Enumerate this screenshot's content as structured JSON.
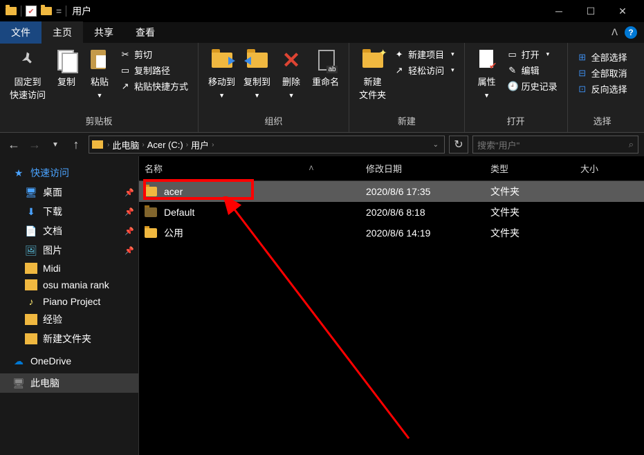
{
  "title": "用户",
  "menu": {
    "file": "文件",
    "home": "主页",
    "share": "共享",
    "view": "查看"
  },
  "ribbon": {
    "clipboard": {
      "label": "剪贴板",
      "pin": "固定到\n快速访问",
      "copy": "复制",
      "paste": "粘贴",
      "cut": "剪切",
      "copypath": "复制路径",
      "pasteshortcut": "粘贴快捷方式"
    },
    "organize": {
      "label": "组织",
      "moveto": "移动到",
      "copyto": "复制到",
      "delete": "删除",
      "rename": "重命名"
    },
    "new": {
      "label": "新建",
      "newfolder": "新建\n文件夹",
      "newitem": "新建项目",
      "easyaccess": "轻松访问"
    },
    "open": {
      "label": "打开",
      "properties": "属性",
      "open": "打开",
      "edit": "编辑",
      "history": "历史记录"
    },
    "select": {
      "label": "选择",
      "all": "全部选择",
      "none": "全部取消",
      "invert": "反向选择"
    }
  },
  "breadcrumb": [
    "此电脑",
    "Acer (C:)",
    "用户"
  ],
  "search_placeholder": "搜索\"用户\"",
  "columns": {
    "name": "名称",
    "date": "修改日期",
    "type": "类型",
    "size": "大小"
  },
  "files": [
    {
      "name": "acer",
      "date": "2020/8/6 17:35",
      "type": "文件夹",
      "selected": true,
      "highlighted": true
    },
    {
      "name": "Default",
      "date": "2020/8/6 8:18",
      "type": "文件夹",
      "dim": true
    },
    {
      "name": "公用",
      "date": "2020/8/6 14:19",
      "type": "文件夹"
    }
  ],
  "sidebar": {
    "quickaccess": "快速访问",
    "items": [
      {
        "label": "桌面",
        "icon": "desktop",
        "pinned": true
      },
      {
        "label": "下载",
        "icon": "download",
        "pinned": true
      },
      {
        "label": "文档",
        "icon": "doc",
        "pinned": true
      },
      {
        "label": "图片",
        "icon": "pic",
        "pinned": true
      },
      {
        "label": "Midi",
        "icon": "fld"
      },
      {
        "label": "osu mania rank",
        "icon": "fld"
      },
      {
        "label": "Piano Project",
        "icon": "music"
      },
      {
        "label": "经验",
        "icon": "fld"
      },
      {
        "label": "新建文件夹",
        "icon": "fld"
      }
    ],
    "onedrive": "OneDrive",
    "thispc": "此电脑"
  }
}
